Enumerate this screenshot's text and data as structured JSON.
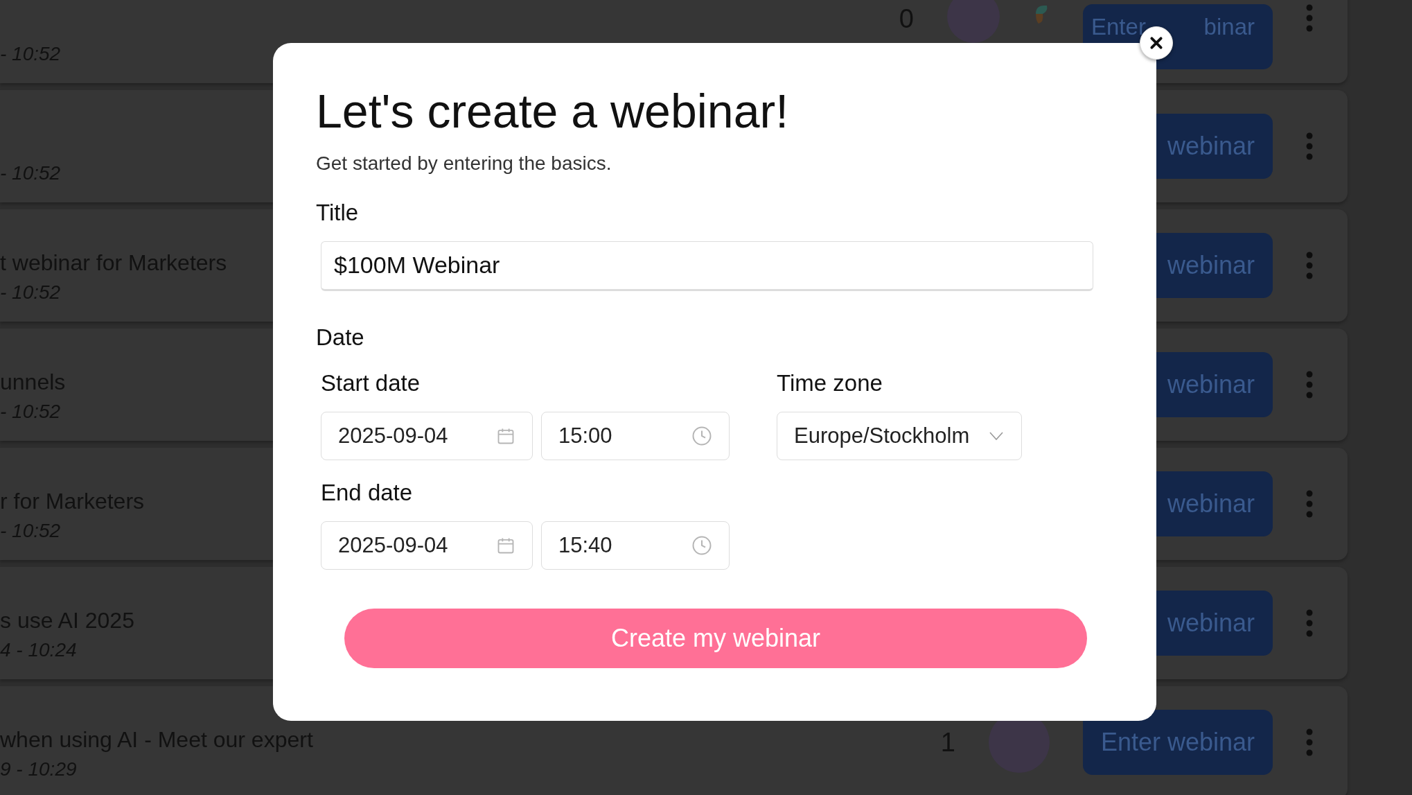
{
  "background_rows": [
    {
      "time": "- 10:52",
      "stats": {
        "count": "0",
        "extra_icon": true
      },
      "button": "Enter",
      "button_tail": "binar"
    },
    {
      "time": "- 10:52",
      "button": "webinar"
    },
    {
      "title": "t webinar for Marketers",
      "time": "- 10:52",
      "button": "webinar"
    },
    {
      "title": "unnels",
      "time": "- 10:52",
      "button": "webinar"
    },
    {
      "title": "r for Marketers",
      "time": "- 10:52",
      "button": "webinar"
    },
    {
      "title": "s use AI 2025",
      "time": "4 - 10:24",
      "button": "webinar"
    },
    {
      "title": "when using AI - Meet our expert",
      "time": "9 - 10:29",
      "stats": {
        "count": "1",
        "extra_icon": false
      },
      "button": "Enter webinar"
    }
  ],
  "modal": {
    "heading": "Let's create a webinar!",
    "subtitle": "Get started by entering the basics.",
    "title_field": {
      "label": "Title",
      "value": "$100M Webinar"
    },
    "date_section": {
      "label": "Date",
      "start": {
        "label": "Start date",
        "date": "2025-09-04",
        "time": "15:00"
      },
      "end": {
        "label": "End date",
        "date": "2025-09-04",
        "time": "15:40"
      },
      "time_zone": {
        "label": "Time zone",
        "value": "Europe/Stockholm"
      }
    },
    "submit_button": "Create my webinar"
  }
}
